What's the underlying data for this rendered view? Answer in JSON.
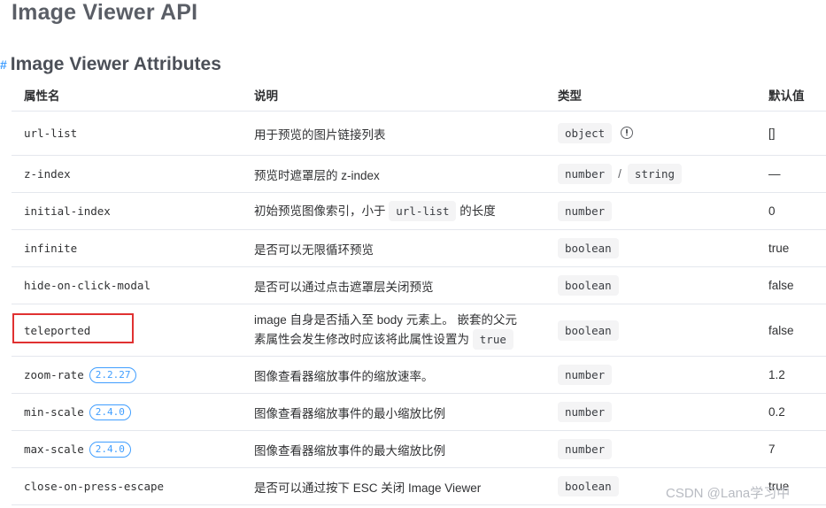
{
  "page_title": "Image Viewer API",
  "section_title": "Image Viewer Attributes",
  "section_anchor": "#",
  "headers": [
    "属性名",
    "说明",
    "类型",
    "默认值"
  ],
  "rows": [
    {
      "name": "url-list",
      "desc": "用于预览的图片链接列表",
      "types": [
        "object"
      ],
      "info": true,
      "default": "[]"
    },
    {
      "name": "z-index",
      "desc": "预览时遮罩层的 z-index",
      "types": [
        "number",
        "string"
      ],
      "default": "—"
    },
    {
      "name": "initial-index",
      "desc_pre": "初始预览图像索引，小于",
      "desc_code": "url-list",
      "desc_post": "的长度",
      "types": [
        "number"
      ],
      "default": "0"
    },
    {
      "name": "infinite",
      "desc": "是否可以无限循环预览",
      "types": [
        "boolean"
      ],
      "default": "true"
    },
    {
      "name": "hide-on-click-modal",
      "desc": "是否可以通过点击遮罩层关闭预览",
      "types": [
        "boolean"
      ],
      "default": "false"
    },
    {
      "name": "teleported",
      "desc_line1": "image 自身是否插入至 body 元素上。 嵌套的父元",
      "desc_line2": "素属性会发生修改时应该将此属性设置为",
      "desc_code": "true",
      "types": [
        "boolean"
      ],
      "default": "false"
    },
    {
      "name": "zoom-rate",
      "badge": "2.2.27",
      "desc": "图像查看器缩放事件的缩放速率。",
      "types": [
        "number"
      ],
      "default": "1.2"
    },
    {
      "name": "min-scale",
      "badge": "2.4.0",
      "desc": "图像查看器缩放事件的最小缩放比例",
      "types": [
        "number"
      ],
      "default": "0.2"
    },
    {
      "name": "max-scale",
      "badge": "2.4.0",
      "desc": "图像查看器缩放事件的最大缩放比例",
      "types": [
        "number"
      ],
      "default": "7"
    },
    {
      "name": "close-on-press-escape",
      "desc": "是否可以通过按下 ESC 关闭 Image Viewer",
      "types": [
        "boolean"
      ],
      "default": "true"
    }
  ],
  "type_separator": "/",
  "watermark": "CSDN @Lana学习中",
  "highlight_color": "#e03131",
  "accent_color": "#409eff"
}
